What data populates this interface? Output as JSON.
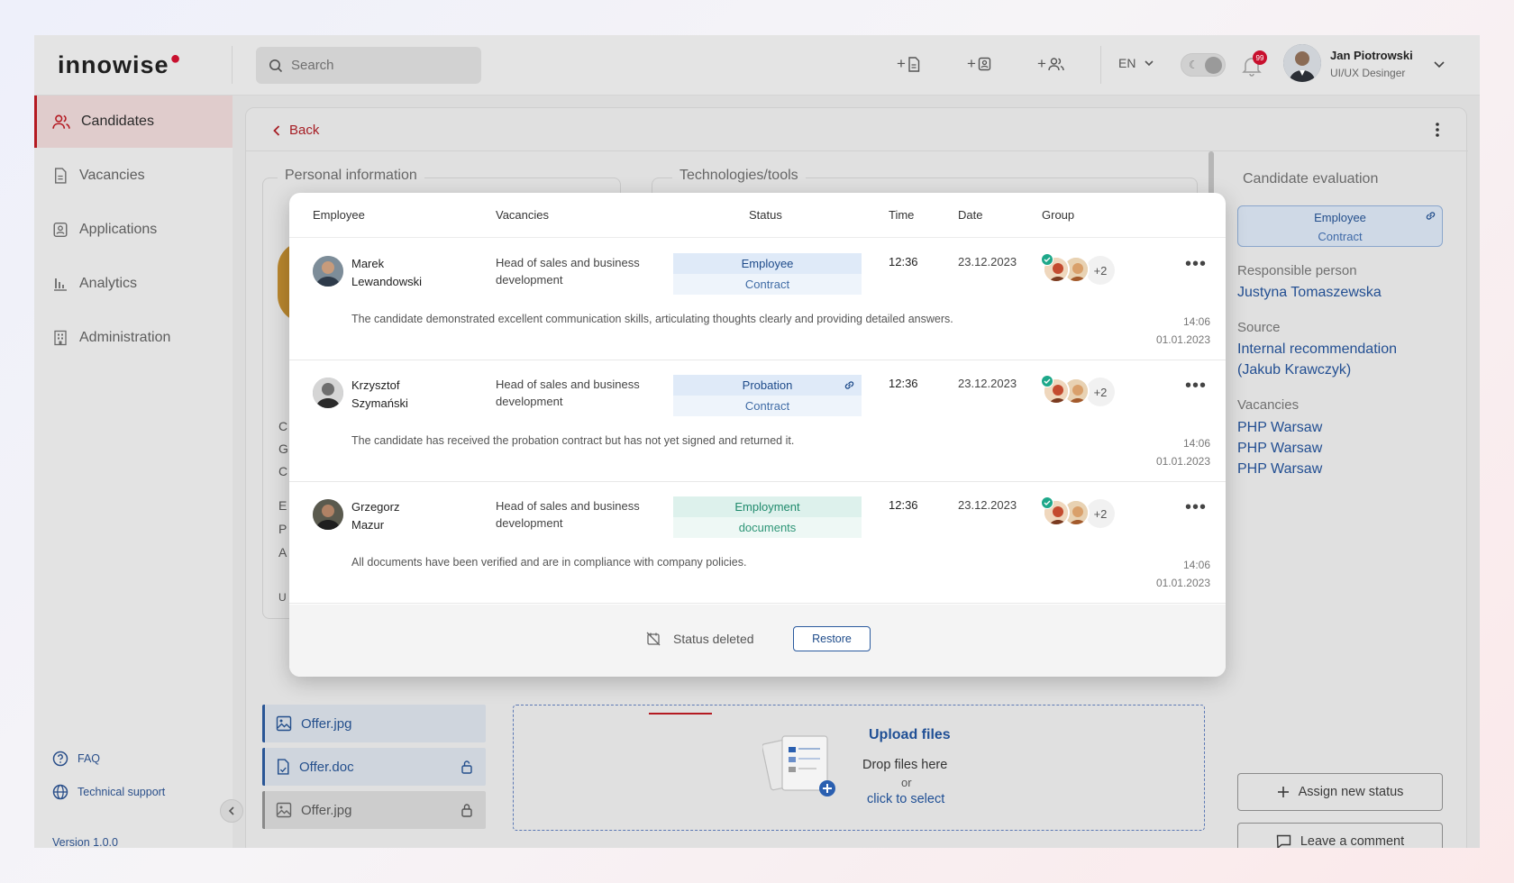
{
  "app": {
    "logo": "innowise"
  },
  "search": {
    "placeholder": "Search"
  },
  "header": {
    "lang": "EN",
    "notifications_count": "99",
    "user_name": "Jan Piotrowski",
    "user_role": "UI/UX Desinger"
  },
  "sidebar": {
    "items": [
      {
        "label": "Candidates",
        "icon": "users-icon",
        "active": true
      },
      {
        "label": "Vacancies",
        "icon": "document-icon"
      },
      {
        "label": "Applications",
        "icon": "application-icon"
      },
      {
        "label": "Analytics",
        "icon": "bar-chart-icon"
      },
      {
        "label": "Administration",
        "icon": "building-icon"
      }
    ],
    "faq": "FAQ",
    "support": "Technical support",
    "version": "Version 1.0.0"
  },
  "main": {
    "back": "Back",
    "personal_info": "Personal information",
    "tech_tools": "Technologies/tools"
  },
  "evaluation": {
    "title": "Candidate evaluation",
    "status_top": "Employee",
    "status_bottom": "Contract",
    "responsible_label": "Responsible person",
    "responsible_value": "Justyna Tomaszewska",
    "source_label": "Source",
    "source_value_1": "Internal recommendation",
    "source_value_2": "(Jakub Krawczyk)",
    "vacancies_label": "Vacancies",
    "vacancies": [
      "PHP Warsaw",
      "PHP Warsaw",
      "PHP Warsaw"
    ],
    "assign_btn": "Assign new status",
    "comment_btn": "Leave a comment"
  },
  "files": [
    {
      "name": "Offer.jpg",
      "style": "blue",
      "locked": false
    },
    {
      "name": "Offer.doc",
      "style": "blue",
      "locked": true
    },
    {
      "name": "Offer.jpg",
      "style": "grey",
      "locked": true
    }
  ],
  "upload": {
    "title": "Upload files",
    "drop": "Drop files here",
    "or": "or",
    "select": "click to select"
  },
  "modal": {
    "columns": [
      "Employee",
      "Vacancies",
      "Status",
      "Time",
      "Date",
      "Group"
    ],
    "rows": [
      {
        "first": "Marek",
        "last": "Lewandowski",
        "vacancy_1": "Head of sales and business",
        "vacancy_2": "development",
        "status_1": "Employee",
        "status_2": "Contract",
        "status_color": "blue",
        "status_link": false,
        "time": "12:36",
        "date": "23.12.2023",
        "group_more": "+2",
        "comment": "The candidate demonstrated excellent communication skills, articulating thoughts clearly and providing detailed answers.",
        "c_time": "14:06",
        "c_date": "01.01.2023"
      },
      {
        "first": "Krzysztof",
        "last": "Szymański",
        "vacancy_1": "Head of sales and business",
        "vacancy_2": "development",
        "status_1": "Probation",
        "status_2": "Contract",
        "status_color": "blue",
        "status_link": true,
        "time": "12:36",
        "date": "23.12.2023",
        "group_more": "+2",
        "comment": "The candidate has received the probation contract but has not yet signed and returned it.",
        "c_time": "14:06",
        "c_date": "01.01.2023"
      },
      {
        "first": "Grzegorz",
        "last": "Mazur",
        "vacancy_1": "Head of sales and business",
        "vacancy_2": "development",
        "status_1": "Employment",
        "status_2": "documents",
        "status_color": "green",
        "status_link": false,
        "time": "12:36",
        "date": "23.12.2023",
        "group_more": "+2",
        "comment": "All documents have been verified and are in compliance with company policies.",
        "c_time": "14:06",
        "c_date": "01.01.2023"
      }
    ],
    "footer_status": "Status deleted",
    "restore": "Restore"
  },
  "colors": {
    "brand_red": "#b41a22",
    "link_blue": "#234f92",
    "success_green": "#1ea88a"
  }
}
